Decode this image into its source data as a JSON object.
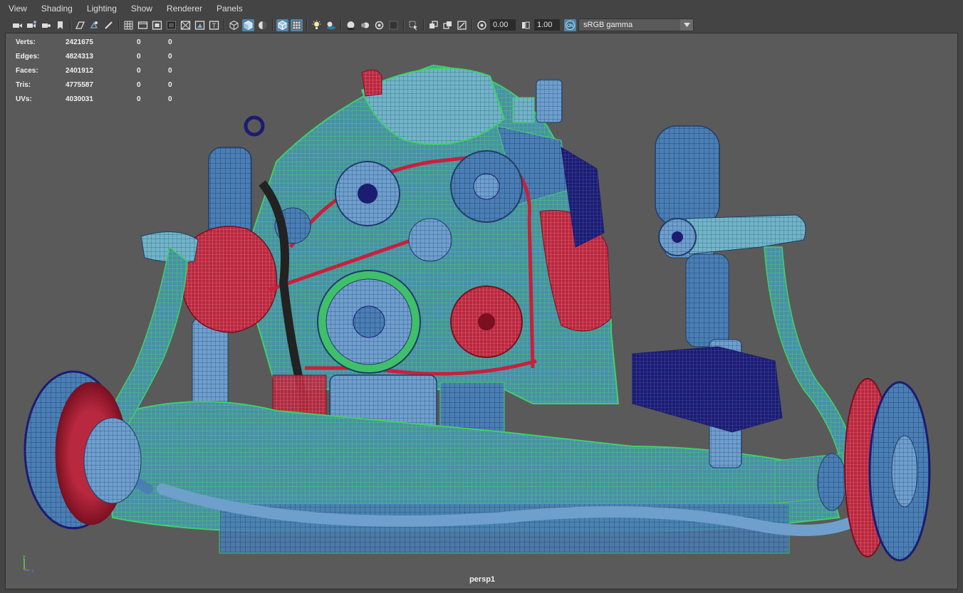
{
  "menubar": {
    "items": [
      "View",
      "Shading",
      "Lighting",
      "Show",
      "Renderer",
      "Panels"
    ]
  },
  "toolbar": {
    "exposure_value": "0.00",
    "gamma_value": "1.00",
    "color_space": "sRGB gamma",
    "icons": [
      "camera-icon",
      "camera-attributes-icon",
      "bookmark-icon",
      "image-plane-icon",
      "grid-icon",
      "film-gate-icon",
      "resolution-gate-icon",
      "gate-mask-icon",
      "field-chart-icon",
      "safe-action-icon",
      "safe-title-icon",
      "wireframe-icon",
      "smooth-shade-icon",
      "default-lighting-icon",
      "wireframe-on-shaded-icon",
      "xray-icon",
      "lights-icon",
      "shadows-icon",
      "ambient-occlusion-icon",
      "motion-blur-icon",
      "anti-aliasing-icon",
      "depth-of-field-icon",
      "isolate-select-icon",
      "xray-joints-icon",
      "xray-active-icon",
      "backface-icon",
      "texture-icon",
      "exposure-icon",
      "gamma-icon",
      "color-management-icon"
    ]
  },
  "hud": {
    "rows": [
      {
        "label": "Verts:",
        "v1": "2421675",
        "v2": "0",
        "v3": "0"
      },
      {
        "label": "Edges:",
        "v1": "4824313",
        "v2": "0",
        "v3": "0"
      },
      {
        "label": "Faces:",
        "v1": "2401912",
        "v2": "0",
        "v3": "0"
      },
      {
        "label": "Tris:",
        "v1": "4775587",
        "v2": "0",
        "v3": "0"
      },
      {
        "label": "UVs:",
        "v1": "4030031",
        "v2": "0",
        "v3": "0"
      }
    ]
  },
  "viewport": {
    "camera": "persp1",
    "axis": {
      "y": "y",
      "z": "z"
    },
    "colors": {
      "background": "#5a5a5a",
      "blue": "#4a7fb5",
      "green": "#3fbf6a",
      "red": "#c8203c",
      "navy": "#1a1a6e"
    }
  }
}
